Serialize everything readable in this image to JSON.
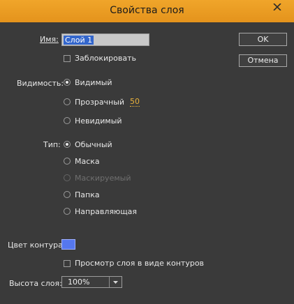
{
  "window": {
    "title": "Свойства слоя"
  },
  "name_field": {
    "label": "Имя:",
    "value": "Слой 1"
  },
  "lock": {
    "label": "Заблокировать",
    "checked": false
  },
  "visibility": {
    "label": "Видимость:",
    "options": [
      {
        "label": "Видимый",
        "selected": true
      },
      {
        "label": "Прозрачный",
        "selected": false
      },
      {
        "label": "Невидимый",
        "selected": false
      }
    ],
    "transparency_value": "50"
  },
  "type": {
    "label": "Тип:",
    "options": [
      {
        "label": "Обычный",
        "selected": true,
        "disabled": false
      },
      {
        "label": "Маска",
        "selected": false,
        "disabled": false
      },
      {
        "label": "Маскируемый",
        "selected": false,
        "disabled": true
      },
      {
        "label": "Папка",
        "selected": false,
        "disabled": false
      },
      {
        "label": "Направляющая",
        "selected": false,
        "disabled": false
      }
    ]
  },
  "outline_color": {
    "label": "Цвет контура:",
    "color": "#5577ee"
  },
  "outline_view": {
    "label": "Просмотр слоя в виде контуров",
    "checked": false
  },
  "layer_height": {
    "label": "Высота слоя:",
    "value": "100%"
  },
  "buttons": {
    "ok": "OK",
    "cancel": "Отмена"
  },
  "colors": {
    "titlebar": "#e8991f",
    "background": "#3a3a3a",
    "accent_value": "#e8b13a",
    "selection": "#3366cc"
  }
}
